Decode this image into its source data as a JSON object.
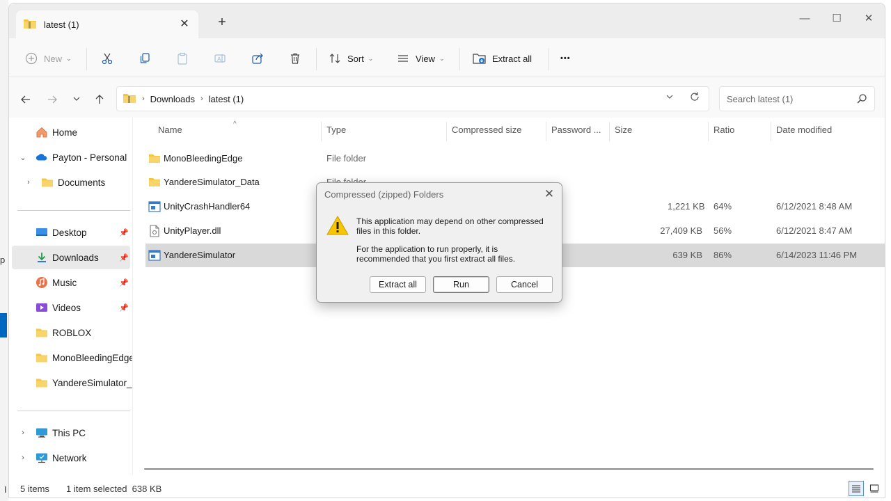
{
  "window": {
    "tab_title": "latest (1)",
    "new_tab": "+",
    "controls": {
      "minimize": "—",
      "maximize": "☐",
      "close": "✕"
    }
  },
  "toolbar": {
    "new_label": "New",
    "sort_label": "Sort",
    "view_label": "View",
    "extract_all_label": "Extract all",
    "more_label": "•••"
  },
  "address": {
    "crumbs": [
      "Downloads",
      "latest (1)"
    ],
    "search_placeholder": "Search latest (1)"
  },
  "sidebar": {
    "items": [
      {
        "label": "Home"
      },
      {
        "label": "Payton - Personal"
      },
      {
        "label": "Documents"
      },
      {
        "label": "Desktop"
      },
      {
        "label": "Downloads"
      },
      {
        "label": "Music"
      },
      {
        "label": "Videos"
      },
      {
        "label": "ROBLOX"
      },
      {
        "label": "MonoBleedingEdge"
      },
      {
        "label": "YandereSimulator_D"
      },
      {
        "label": "This PC"
      },
      {
        "label": "Network"
      }
    ]
  },
  "columns": [
    "Name",
    "Type",
    "Compressed size",
    "Password ...",
    "Size",
    "Ratio",
    "Date modified"
  ],
  "files": [
    {
      "name": "MonoBleedingEdge",
      "type": "File folder",
      "size": "",
      "ratio": "",
      "date": "",
      "icon": "folder-icon"
    },
    {
      "name": "YandereSimulator_Data",
      "type": "File folder",
      "size": "",
      "ratio": "",
      "date": "",
      "icon": "folder-icon"
    },
    {
      "name": "UnityCrashHandler64",
      "type": "",
      "size": "1,221 KB",
      "ratio": "64%",
      "date": "6/12/2021 8:48 AM",
      "icon": "exe-icon"
    },
    {
      "name": "UnityPlayer.dll",
      "type": "",
      "size": "27,409 KB",
      "ratio": "56%",
      "date": "6/12/2021 8:47 AM",
      "icon": "dll-icon"
    },
    {
      "name": "YandereSimulator",
      "type": "",
      "size": "639 KB",
      "ratio": "86%",
      "date": "6/14/2023 11:46 PM",
      "icon": "exe-icon"
    }
  ],
  "status": {
    "items": "5 items",
    "selected": "1 item selected  638 KB"
  },
  "dialog": {
    "title": "Compressed (zipped) Folders",
    "close": "✕",
    "message1": "This application may depend on other compressed files in this folder.",
    "message2": "For the application to run properly, it is recommended that you first extract all files.",
    "extract_all": "Extract all",
    "run": "Run",
    "cancel": "Cancel"
  },
  "background": {
    "fragment_top": "p",
    "fragment_bottom": "I"
  },
  "colors": {
    "accent": "#0067c0",
    "selected_row": "#d9d9d9",
    "folder": "#f4c542"
  }
}
